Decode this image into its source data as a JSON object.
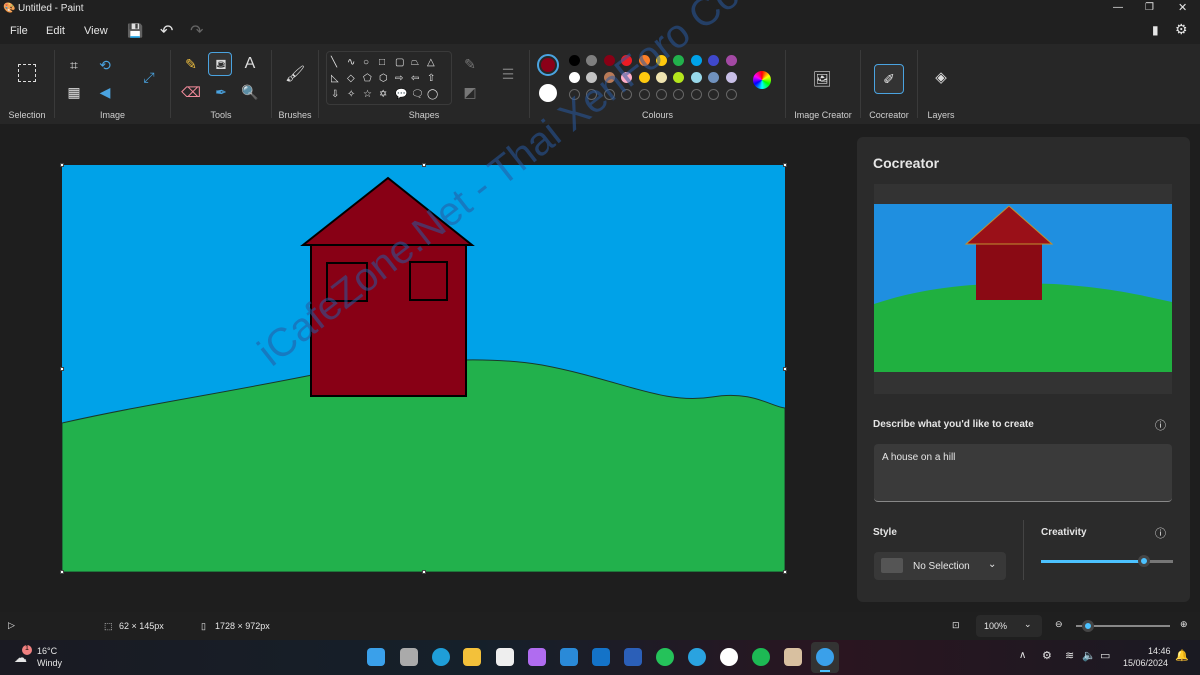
{
  "window": {
    "title": "Untitled - Paint"
  },
  "menu": {
    "file": "File",
    "edit": "Edit",
    "view": "View"
  },
  "ribbon": {
    "groups": {
      "selection": "Selection",
      "image": "Image",
      "tools": "Tools",
      "brushes": "Brushes",
      "shapes": "Shapes",
      "colours": "Colours",
      "image_creator": "Image Creator",
      "cocreator": "Cocreator",
      "layers": "Layers"
    },
    "primary_color": "#8b0018",
    "secondary_color": "#ffffff",
    "palette_row1": [
      "#000000",
      "#7f7f7f",
      "#880015",
      "#ed1c24",
      "#ff7f27",
      "#ffc90e",
      "#22b14c",
      "#00a2e8",
      "#3f48cc",
      "#a349a4"
    ],
    "palette_row2": [
      "#ffffff",
      "#c3c3c3",
      "#b97a57",
      "#ffaec9",
      "#ffc90e",
      "#efe4b0",
      "#b5e61d",
      "#99d9ea",
      "#7092be",
      "#c8bfe7"
    ],
    "shapes": [
      "╲",
      "∿",
      "○",
      "□",
      "▢",
      "⏢",
      "△",
      "◺",
      "◇",
      "⬠",
      "⬡",
      "⇨",
      "⇦",
      "⇧",
      "⇩",
      "✧",
      "☆",
      "✡",
      "💬",
      "🗨",
      "◯"
    ]
  },
  "canvas": {
    "sky": "#00a2e8",
    "grass": "#22b14c",
    "house": "#880015"
  },
  "cocreator": {
    "title": "Cocreator",
    "prompt_label": "Describe what you'd like to create",
    "prompt_value": "A house on a hill",
    "style_label": "Style",
    "style_value": "No Selection",
    "creativity_label": "Creativity",
    "creativity_level": 0.78
  },
  "status": {
    "cursor_pos": "",
    "selection_size": "62 × 145px",
    "canvas_size": "1728 × 972px",
    "zoom": "100%",
    "zoom_slider": 0.1
  },
  "taskbar": {
    "weather_temp": "16°C",
    "weather_desc": "Windy",
    "weather_badge": "1",
    "time": "14:46",
    "date": "15/06/2024"
  },
  "watermark": "iCafeZone.Net - Thai XenForo Community"
}
